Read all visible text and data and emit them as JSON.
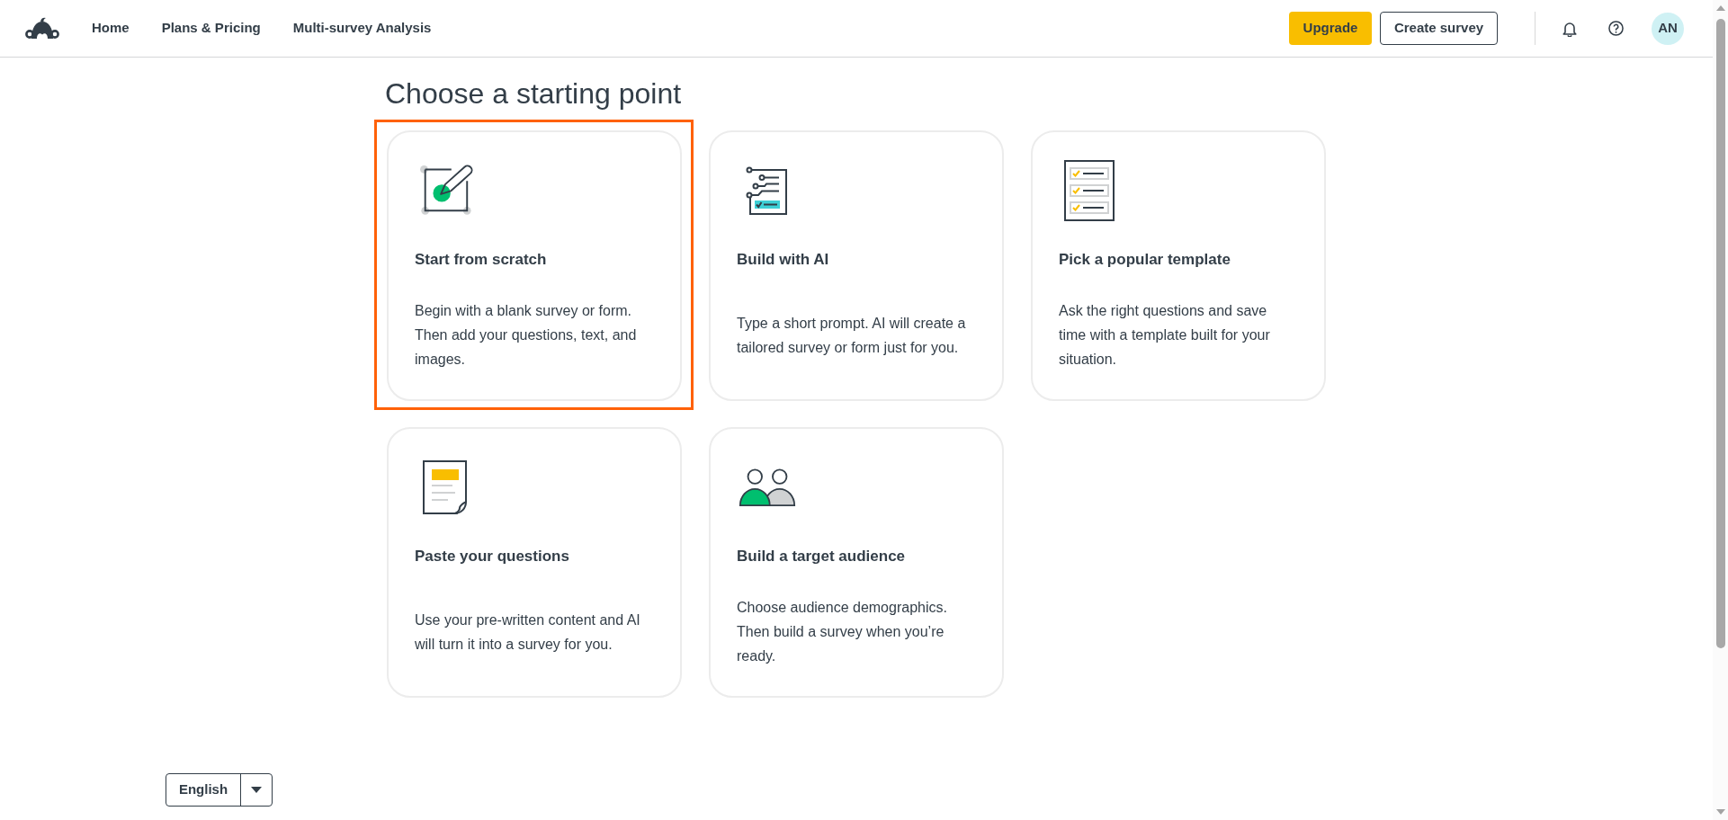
{
  "header": {
    "nav": [
      "Home",
      "Plans & Pricing",
      "Multi-survey Analysis"
    ],
    "upgrade": "Upgrade",
    "create_survey": "Create survey",
    "avatar_initials": "AN"
  },
  "title": "Choose a starting point",
  "options": [
    {
      "kind": "scratch",
      "title": "Start from scratch",
      "description": "Begin with a blank survey or form. Then add your questions, text, and images.",
      "selected": true
    },
    {
      "kind": "ai",
      "title": "Build with AI",
      "description": "Type a short prompt. AI will create a tailored survey or form just for you.",
      "selected": false
    },
    {
      "kind": "template",
      "title": "Pick a popular template",
      "description": "Ask the right questions and save time with a template built for your situation.",
      "selected": false
    },
    {
      "kind": "paste",
      "title": "Paste your questions",
      "description": "Use your pre-written content and AI will turn it into a survey for you.",
      "selected": false
    },
    {
      "kind": "audience",
      "title": "Build a target audience",
      "description": "Choose audience demographics. Then build a survey when you’re ready.",
      "selected": false
    }
  ],
  "footer": {
    "language": "English"
  }
}
